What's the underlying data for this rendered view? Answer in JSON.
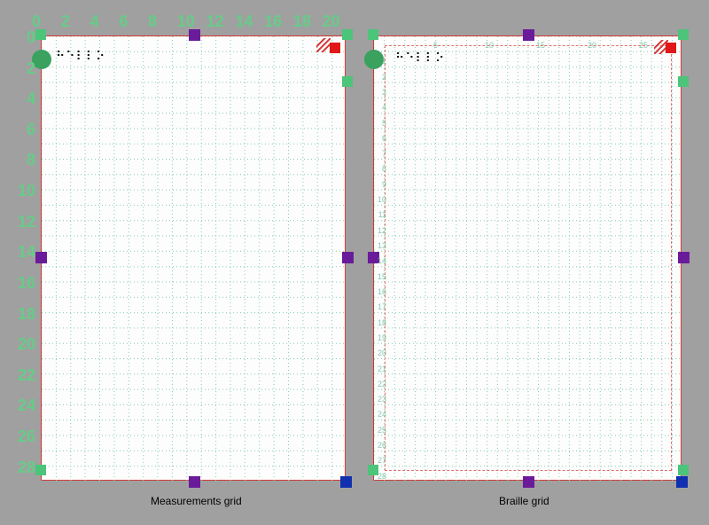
{
  "caption_left": "Measurements grid",
  "caption_right": "Braille grid",
  "braille_sample": "⠓⠑⠇⠇⠕",
  "left_ruler_top": [
    "0",
    "2",
    "4",
    "6",
    "8",
    "10",
    "12",
    "14",
    "16",
    "18",
    "20"
  ],
  "left_ruler_side": [
    "0",
    "2",
    "4",
    "6",
    "8",
    "10",
    "12",
    "14",
    "16",
    "18",
    "20",
    "22",
    "24",
    "26",
    "28"
  ],
  "right_ruler_top": [
    "5",
    "10",
    "15",
    "20",
    "25"
  ],
  "right_ruler_side": [
    "1",
    "2",
    "3",
    "4",
    "5",
    "6",
    "7",
    "8",
    "9",
    "10",
    "11",
    "12",
    "13",
    "14",
    "15",
    "16",
    "17",
    "18",
    "19",
    "20",
    "21",
    "22",
    "23",
    "24",
    "25",
    "26",
    "27",
    "28"
  ],
  "colors": {
    "page_border": "#d43838",
    "grid_major": "#88ccaa",
    "purple": "#6a1b9a",
    "green": "#4cc47a",
    "red": "#e01818",
    "blue": "#1030b0"
  },
  "left_grid": {
    "cols": 21,
    "rows": 29
  },
  "right_grid": {
    "cols": 30,
    "rows": 29
  }
}
